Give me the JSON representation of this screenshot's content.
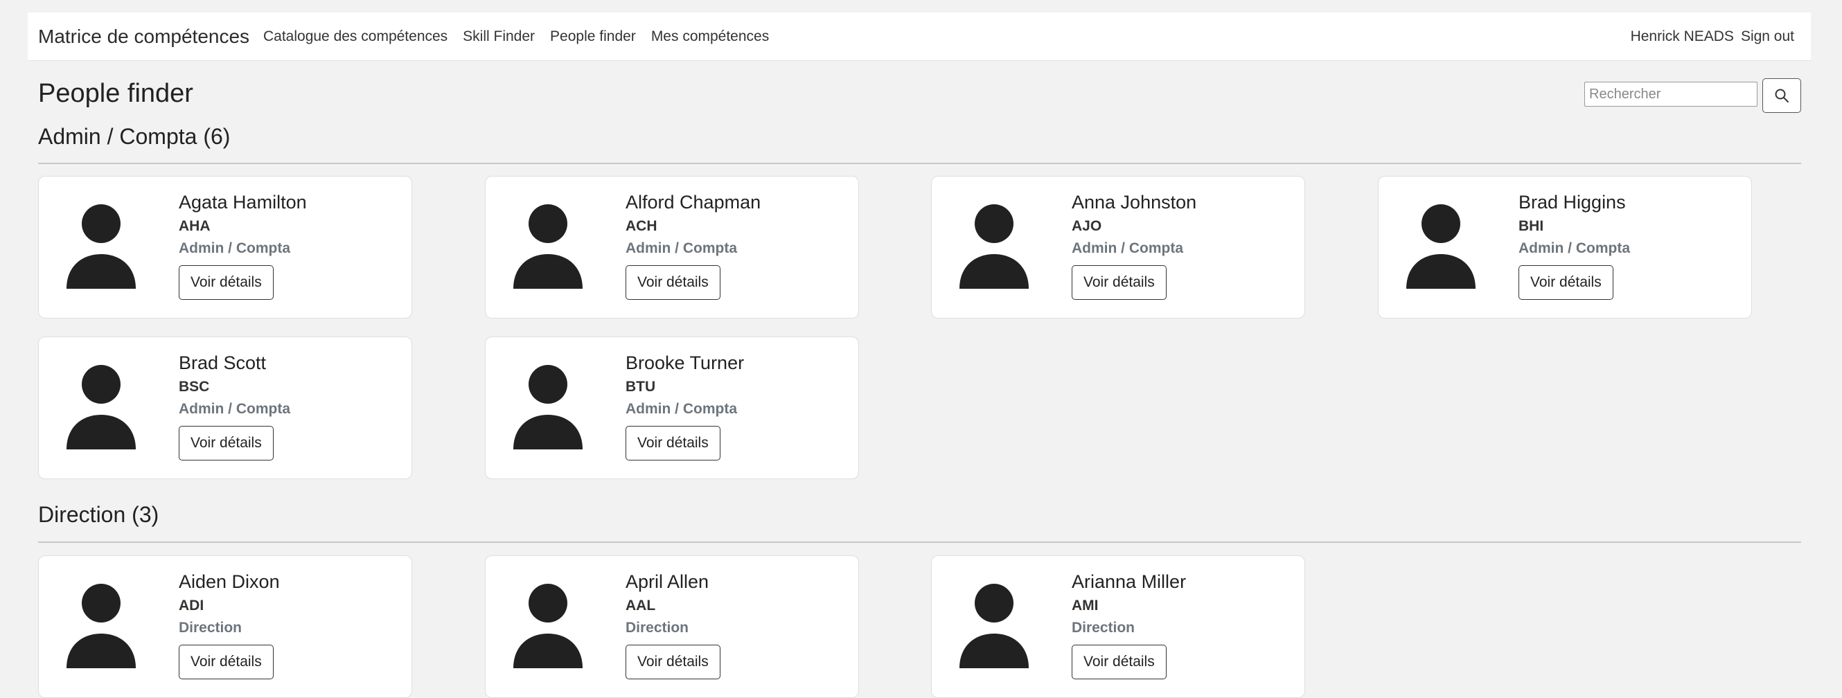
{
  "navbar": {
    "brand": "Matrice de compétences",
    "links": [
      "Catalogue des compétences",
      "Skill Finder",
      "People finder",
      "Mes compétences"
    ],
    "user_name": "Henrick NEADS",
    "sign_out": "Sign out"
  },
  "page": {
    "title": "People finder"
  },
  "search": {
    "placeholder": "Rechercher",
    "icon": "search-icon"
  },
  "sections": [
    {
      "title": "Admin / Compta (6)",
      "people": [
        {
          "name": "Agata Hamilton",
          "code": "AHA",
          "department": "Admin / Compta",
          "button": "Voir détails"
        },
        {
          "name": "Alford Chapman",
          "code": "ACH",
          "department": "Admin / Compta",
          "button": "Voir détails"
        },
        {
          "name": "Anna Johnston",
          "code": "AJO",
          "department": "Admin / Compta",
          "button": "Voir détails"
        },
        {
          "name": "Brad Higgins",
          "code": "BHI",
          "department": "Admin / Compta",
          "button": "Voir détails"
        },
        {
          "name": "Brad Scott",
          "code": "BSC",
          "department": "Admin / Compta",
          "button": "Voir détails"
        },
        {
          "name": "Brooke Turner",
          "code": "BTU",
          "department": "Admin / Compta",
          "button": "Voir détails"
        }
      ]
    },
    {
      "title": "Direction (3)",
      "people": [
        {
          "name": "Aiden Dixon",
          "code": "ADI",
          "department": "Direction",
          "button": "Voir détails"
        },
        {
          "name": "April Allen",
          "code": "AAL",
          "department": "Direction",
          "button": "Voir détails"
        },
        {
          "name": "Arianna Miller",
          "code": "AMI",
          "department": "Direction",
          "button": "Voir détails"
        }
      ]
    }
  ],
  "colors": {
    "background": "#f2f2f2",
    "card": "#ffffff",
    "avatar": "#212121",
    "muted_text": "#6c757d"
  }
}
